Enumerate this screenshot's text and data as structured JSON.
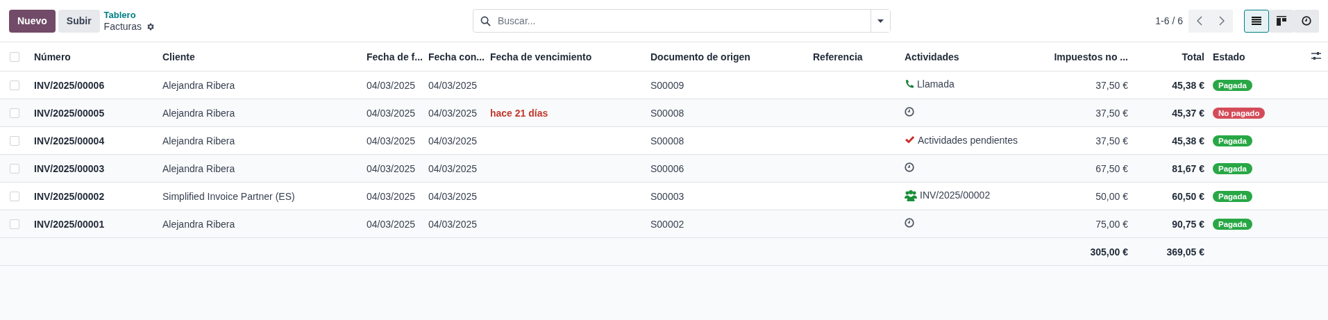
{
  "control_panel": {
    "new_button": "Nuevo",
    "upload_button": "Subir",
    "breadcrumb": "Tablero",
    "title": "Facturas"
  },
  "search": {
    "placeholder": "Buscar..."
  },
  "pager": {
    "text": "1-6 / 6"
  },
  "views": [
    {
      "kind": "list",
      "selected": true
    },
    {
      "kind": "kanban",
      "selected": false
    },
    {
      "kind": "activity",
      "selected": false
    }
  ],
  "table": {
    "select_all": {
      "checked": false
    },
    "columns": [
      {
        "label": "Número"
      },
      {
        "label": "Cliente"
      },
      {
        "label": "Fecha de f..."
      },
      {
        "label": "Fecha con..."
      },
      {
        "label": "Fecha de vencimiento"
      },
      {
        "label": "Documento de origen"
      },
      {
        "label": "Referencia"
      },
      {
        "label": "Actividades"
      },
      {
        "label": "Impuestos no ..."
      },
      {
        "label": "Total"
      },
      {
        "label": "Estado"
      }
    ],
    "rows": [
      {
        "checked": false,
        "number": "INV/2025/00006",
        "client": "Alejandra Ribera",
        "invoice_date": "04/03/2025",
        "accounting_date": "04/03/2025",
        "source": "S00009",
        "activity": {
          "kind": "phone",
          "label": "Llamada"
        },
        "untaxed": "37,50 €",
        "total": "45,38 €",
        "status": {
          "label": "Pagada",
          "color": "#28a745"
        }
      },
      {
        "checked": false,
        "number": "INV/2025/00005",
        "client": "Alejandra Ribera",
        "invoice_date": "04/03/2025",
        "accounting_date": "04/03/2025",
        "due": "hace 21 días",
        "source": "S00008",
        "activity": {
          "kind": "clock"
        },
        "untaxed": "37,50 €",
        "total": "45,37 €",
        "status": {
          "label": "No pagado",
          "color": "#d44c59"
        }
      },
      {
        "checked": false,
        "number": "INV/2025/00004",
        "client": "Alejandra Ribera",
        "invoice_date": "04/03/2025",
        "accounting_date": "04/03/2025",
        "source": "S00008",
        "activity": {
          "kind": "check",
          "label": "Actividades pendientes"
        },
        "untaxed": "37,50 €",
        "total": "45,38 €",
        "status": {
          "label": "Pagada",
          "color": "#28a745"
        }
      },
      {
        "checked": false,
        "number": "INV/2025/00003",
        "client": "Alejandra Ribera",
        "invoice_date": "04/03/2025",
        "accounting_date": "04/03/2025",
        "source": "S00006",
        "activity": {
          "kind": "clock"
        },
        "untaxed": "67,50 €",
        "total": "81,67 €",
        "status": {
          "label": "Pagada",
          "color": "#28a745"
        }
      },
      {
        "checked": false,
        "number": "INV/2025/00002",
        "client": "Simplified Invoice Partner (ES)",
        "invoice_date": "04/03/2025",
        "accounting_date": "04/03/2025",
        "source": "S00003",
        "activity": {
          "kind": "group",
          "label": "INV/2025/00002"
        },
        "untaxed": "50,00 €",
        "total": "60,50 €",
        "status": {
          "label": "Pagada",
          "color": "#28a745"
        }
      },
      {
        "checked": false,
        "number": "INV/2025/00001",
        "client": "Alejandra Ribera",
        "invoice_date": "04/03/2025",
        "accounting_date": "04/03/2025",
        "source": "S00002",
        "activity": {
          "kind": "clock"
        },
        "untaxed": "75,00 €",
        "total": "90,75 €",
        "status": {
          "label": "Pagada",
          "color": "#28a745"
        }
      }
    ],
    "footer": {
      "untaxed": "305,00 €",
      "total": "369,05 €"
    }
  }
}
